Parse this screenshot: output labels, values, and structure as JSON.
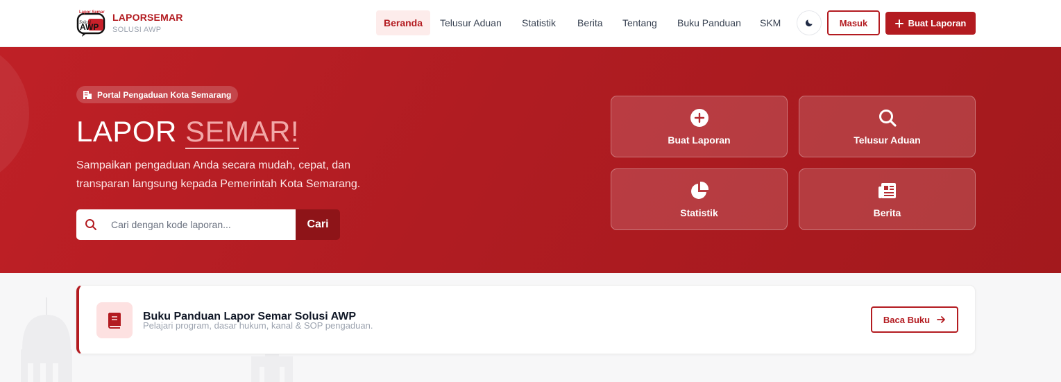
{
  "brand": {
    "title": "LAPORSEMAR",
    "subtitle": "SOLUSI AWP",
    "logo_text": "AWP"
  },
  "nav": {
    "items": [
      {
        "label": "Beranda",
        "active": true
      },
      {
        "label": "Telusur Aduan"
      },
      {
        "label": "Statistik"
      },
      {
        "label": "Berita"
      },
      {
        "label": "Tentang"
      },
      {
        "label": "Buku Panduan"
      },
      {
        "label": "SKM"
      }
    ],
    "login_label": "Masuk",
    "create_label": "Buat Laporan"
  },
  "hero": {
    "badge": "Portal Pengaduan Kota Semarang",
    "title_main": "LAPOR ",
    "title_accent": "SEMAR!",
    "description": "Sampaikan pengaduan Anda secara mudah, cepat, dan transparan langsung kepada Pemerintah Kota Semarang.",
    "search_placeholder": "Cari dengan kode laporan...",
    "search_button": "Cari"
  },
  "quick_actions": [
    {
      "label": "Buat Laporan",
      "icon": "plus-circle-icon"
    },
    {
      "label": "Telusur Aduan",
      "icon": "search-icon"
    },
    {
      "label": "Statistik",
      "icon": "pie-chart-icon"
    },
    {
      "label": "Berita",
      "icon": "newspaper-icon"
    }
  ],
  "guide": {
    "title": "Buku Panduan Lapor Semar Solusi AWP",
    "subtitle": "Pelajari program, dasar hukum, kanal & SOP pengaduan.",
    "button": "Baca Buku"
  },
  "colors": {
    "primary": "#b31b20",
    "primary_dark": "#8e1418",
    "accent_light": "#f2a8a8"
  }
}
